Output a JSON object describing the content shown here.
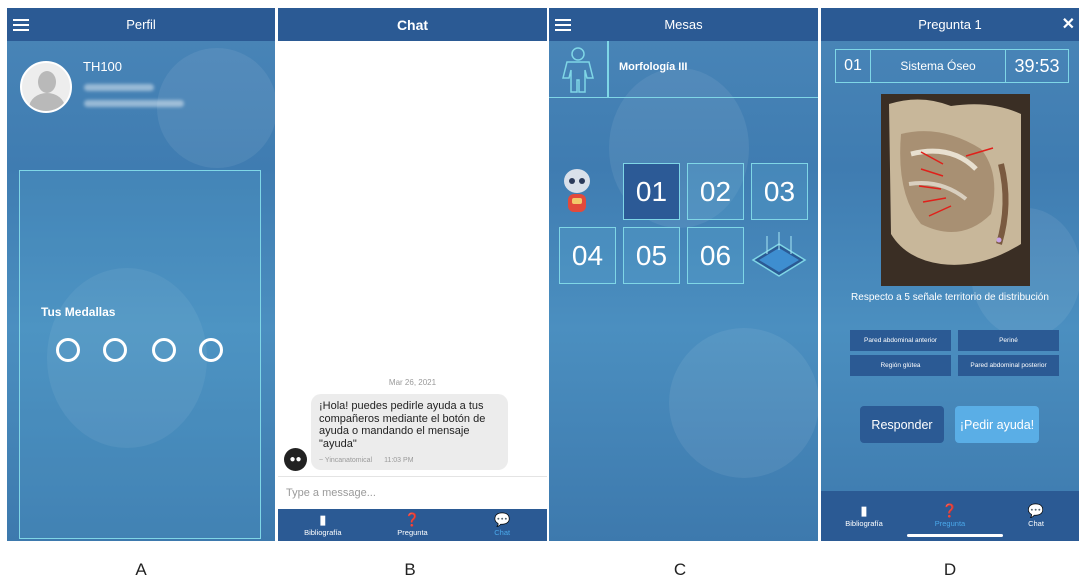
{
  "panelA": {
    "title": "Perfil",
    "user_id": "TH100",
    "medals_label": "Tus Medallas"
  },
  "panelB": {
    "title": "Chat",
    "date": "Mar 26, 2021",
    "message": "¡Hola! puedes pedirle ayuda a tus compañeros mediante el botón de ayuda o mandando el mensaje \"ayuda\"",
    "sender": "~ Yincanatomical",
    "time": "11:03 PM",
    "input_placeholder": "Type a message...",
    "tabs": [
      {
        "label": "Bibliografía",
        "icon": "book-icon"
      },
      {
        "label": "Pregunta",
        "icon": "question-icon"
      },
      {
        "label": "Chat",
        "icon": "chat-bubble-icon"
      }
    ]
  },
  "panelC": {
    "title": "Mesas",
    "subject": "Morfología III",
    "tables": [
      "01",
      "02",
      "03",
      "04",
      "05",
      "06"
    ],
    "selected_table": "01"
  },
  "panelD": {
    "title": "Pregunta 1",
    "question_num": "01",
    "topic": "Sistema Óseo",
    "timer": "39:53",
    "question": "Respecto a 5 señale territorio de distribución",
    "answers": [
      "Pared abdominal anterior",
      "Periné",
      "Región glútea",
      "Pared abdominal posterior"
    ],
    "respond_label": "Responder",
    "help_label": "¡Pedir ayuda!",
    "tabs": [
      {
        "label": "Bibliografía",
        "icon": "book-icon"
      },
      {
        "label": "Pregunta",
        "icon": "question-icon"
      },
      {
        "label": "Chat",
        "icon": "chat-bubble-icon"
      }
    ]
  },
  "figure_labels": [
    "A",
    "B",
    "C",
    "D"
  ],
  "colors": {
    "appbar": "#2b5a94",
    "accent": "#7fd6e6",
    "help_button": "#5aaee6",
    "active_tab": "#4aa8ea"
  }
}
